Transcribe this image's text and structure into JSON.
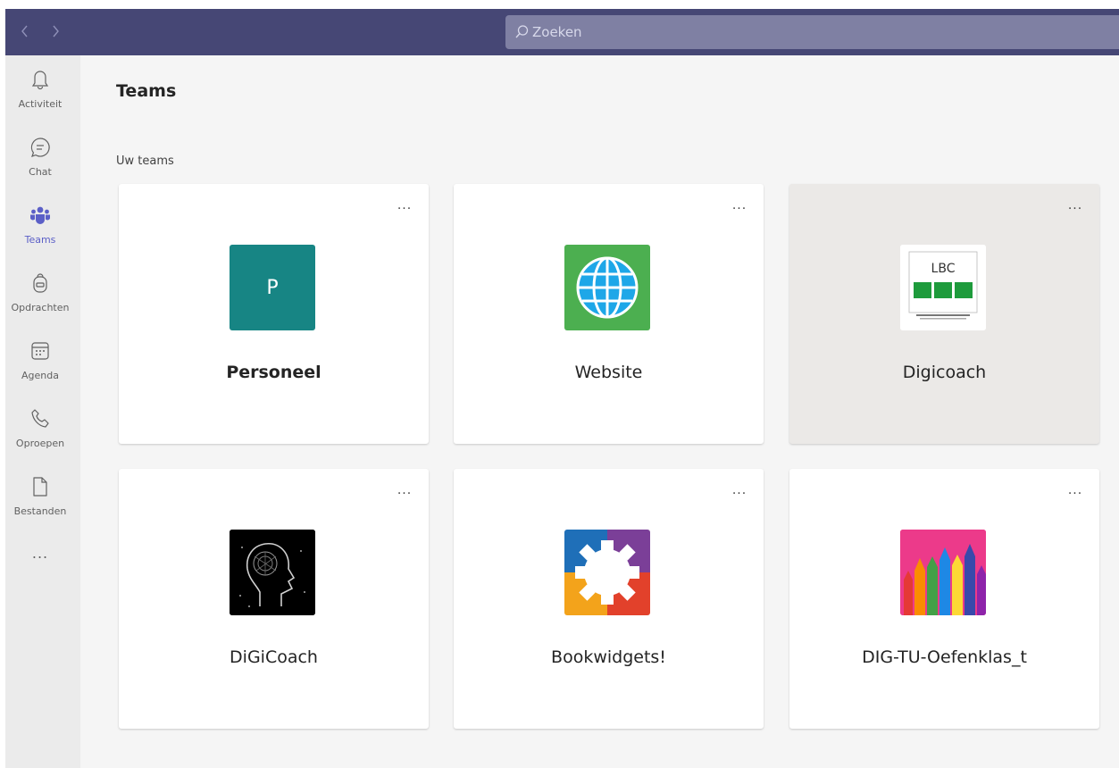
{
  "titlebar": {
    "back_icon": "chevron-left-icon",
    "forward_icon": "chevron-right-icon",
    "search": {
      "placeholder": "Zoeken",
      "icon": "search-icon"
    }
  },
  "rail": {
    "items": [
      {
        "label": "Activiteit",
        "icon": "bell-icon",
        "active": false
      },
      {
        "label": "Chat",
        "icon": "chat-icon",
        "active": false
      },
      {
        "label": "Teams",
        "icon": "teams-icon",
        "active": true
      },
      {
        "label": "Opdrachten",
        "icon": "backpack-icon",
        "active": false
      },
      {
        "label": "Agenda",
        "icon": "calendar-icon",
        "active": false
      },
      {
        "label": "Oproepen",
        "icon": "phone-icon",
        "active": false
      },
      {
        "label": "Bestanden",
        "icon": "file-icon",
        "active": false
      }
    ],
    "more_label": "..."
  },
  "main": {
    "title": "Teams",
    "section_label": "Uw teams",
    "more_label": "...",
    "teams": [
      {
        "name": "Personeel",
        "logo_letter": "P",
        "logo_color": "#178584",
        "bold": true
      },
      {
        "name": "Website",
        "logo_color": "#4caf50"
      },
      {
        "name": "Digicoach",
        "logo_text": "LBC",
        "logo_color": "#1e9b3c"
      },
      {
        "name": "DiGiCoach",
        "logo_color": "#000000"
      },
      {
        "name": "Bookwidgets!",
        "logo_color": "#ffffff"
      },
      {
        "name": "DIG-TU-Oefenklas_t",
        "logo_color": "#ec3a8a"
      }
    ]
  },
  "colors": {
    "titlebar": "#464775",
    "search": "#7f80a3",
    "rail": "#ebebeb",
    "accent": "#5b5fc7",
    "background": "#f5f5f5"
  }
}
